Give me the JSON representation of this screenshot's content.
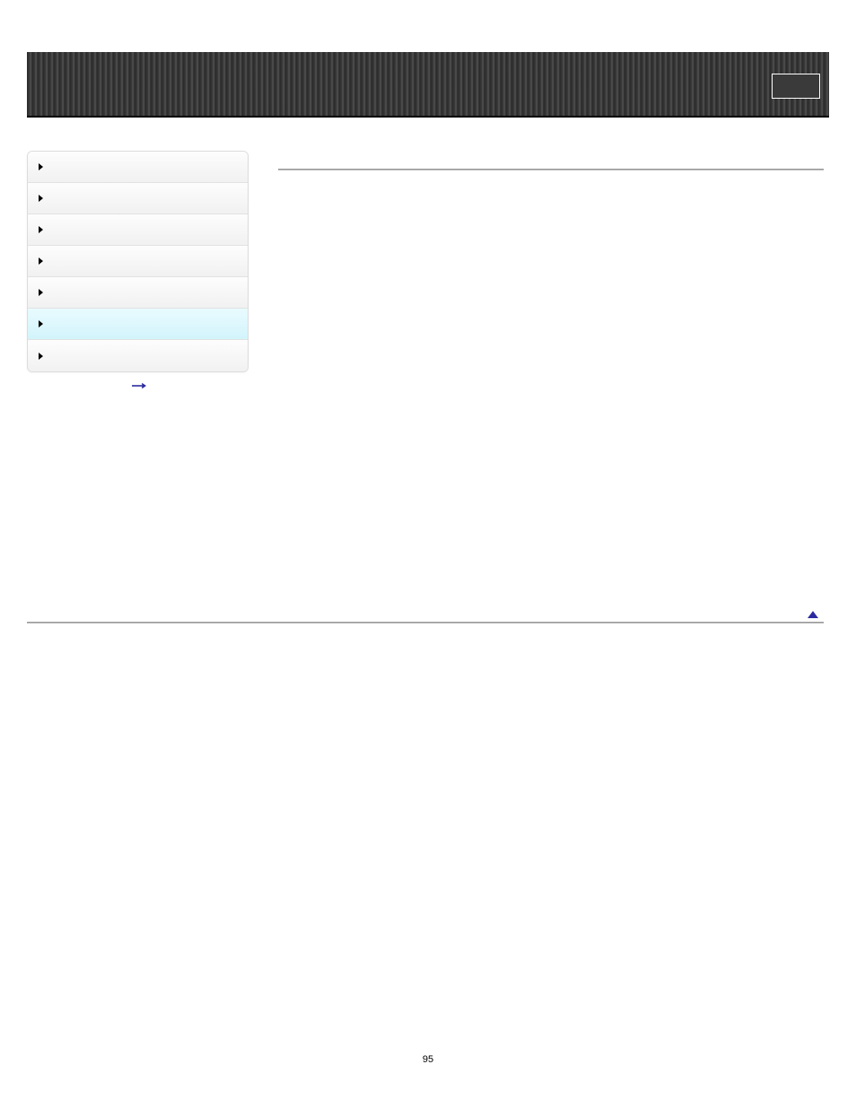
{
  "banner": {
    "title": "",
    "box_label": ""
  },
  "sidebar": {
    "items": [
      {
        "label": "",
        "active": false
      },
      {
        "label": "",
        "active": false
      },
      {
        "label": "",
        "active": false
      },
      {
        "label": "",
        "active": false
      },
      {
        "label": "",
        "active": false
      },
      {
        "label": "",
        "active": true
      },
      {
        "label": "",
        "active": false
      }
    ],
    "expand_all_label": ""
  },
  "main": {
    "heading1": "",
    "heading2": "",
    "paragraphs": [
      "",
      "",
      ""
    ]
  },
  "footer": {
    "top_of_page_label": ""
  },
  "page_number": "95"
}
